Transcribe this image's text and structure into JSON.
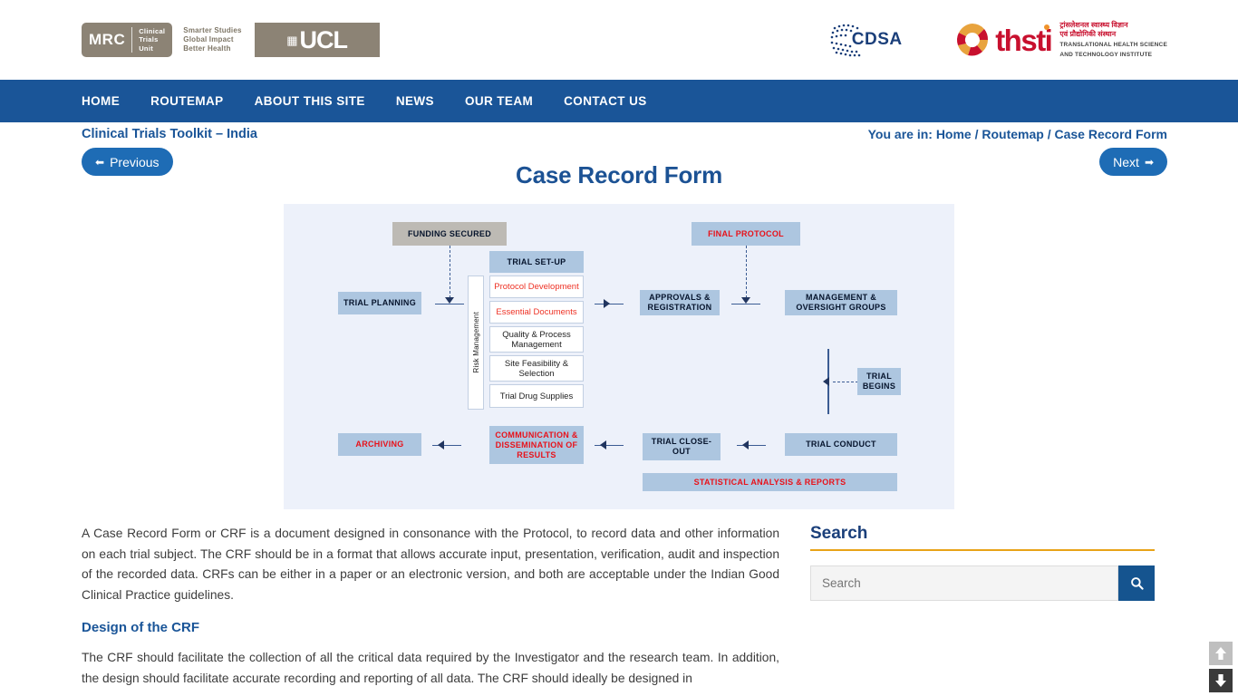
{
  "header": {
    "mrc": {
      "acronym": "MRC",
      "lines": [
        "Clinical",
        "Trials",
        "Unit"
      ]
    },
    "mrc_tagline": [
      "Smarter Studies",
      "Global Impact",
      "Better Health"
    ],
    "ucl": "UCL",
    "cdsa": {
      "name": "CDSA",
      "sub": ""
    },
    "thsti": {
      "word": "thsti",
      "hindi": [
        "ट्रांसलेशनल स्वास्थ्य विज्ञान",
        "एवं प्रौद्योगिकी संस्थान"
      ],
      "english": [
        "TRANSLATIONAL HEALTH SCIENCE",
        "AND TECHNOLOGY INSTITUTE"
      ]
    }
  },
  "nav": {
    "items": [
      {
        "label": "HOME"
      },
      {
        "label": "ROUTEMAP"
      },
      {
        "label": "ABOUT THIS SITE"
      },
      {
        "label": "NEWS"
      },
      {
        "label": "OUR TEAM"
      },
      {
        "label": "CONTACT US"
      }
    ]
  },
  "subbar": {
    "toolkit_title": "Clinical Trials Toolkit – India",
    "breadcrumb": "You are in: Home / Routemap / Case Record Form"
  },
  "title_row": {
    "prev_label": "Previous",
    "prev_arrow": "⬅",
    "next_label": "Next",
    "next_arrow": "➡",
    "page_title": "Case Record Form"
  },
  "diagram": {
    "funding_secured": "FUNDING SECURED",
    "final_protocol": "FINAL PROTOCOL",
    "trial_planning": "TRIAL PLANNING",
    "trial_setup": "TRIAL SET-UP",
    "risk_management": "Risk Management",
    "setup_items": [
      "Protocol Development",
      "Essential Documents",
      "Quality & Process Management",
      "Site Feasibility & Selection",
      "Trial Drug Supplies"
    ],
    "approvals": "APPROVALS & REGISTRATION",
    "management": "MANAGEMENT & OVERSIGHT GROUPS",
    "trial_begins": "TRIAL BEGINS",
    "archiving": "ARCHIVING",
    "communication": "COMMUNICATION & DISSEMINATION OF RESULTS",
    "trial_closeout": "TRIAL CLOSE-OUT",
    "trial_conduct": "TRIAL CONDUCT",
    "statistical": "STATISTICAL ANALYSIS & REPORTS"
  },
  "main": {
    "paragraph_1": "A Case Record Form or CRF is a document designed in consonance with the Protocol, to record data and other information on each trial subject. The CRF should be in a format that allows accurate input, presentation, verification, audit and inspection of the recorded data. CRFs can be either in a paper or an electronic version, and both are acceptable under the Indian Good Clinical Practice guidelines.",
    "subheading_1": "Design of the CRF",
    "paragraph_2": "The CRF should facilitate the collection of all the critical data required by the Investigator and the research team. In addition, the design should facilitate accurate recording and reporting of all data. The CRF should ideally be designed in"
  },
  "sidebar": {
    "search_heading": "Search",
    "search_placeholder": "Search",
    "search_value": ""
  },
  "scroll": {
    "up_label": "UP",
    "down_label": "DOWN"
  },
  "colors": {
    "nav_blue": "#1a5598",
    "accent_blue": "#1e6cb5",
    "title_blue": "#1c5294",
    "diagram_bg": "#edf1fa",
    "box_blue": "#adc6e0",
    "box_grey": "#bdbab4",
    "red_text": "#e8121a",
    "rule_gold": "#e8a317",
    "logo_brown": "#8c8375",
    "thsti_red": "#c8102e"
  }
}
